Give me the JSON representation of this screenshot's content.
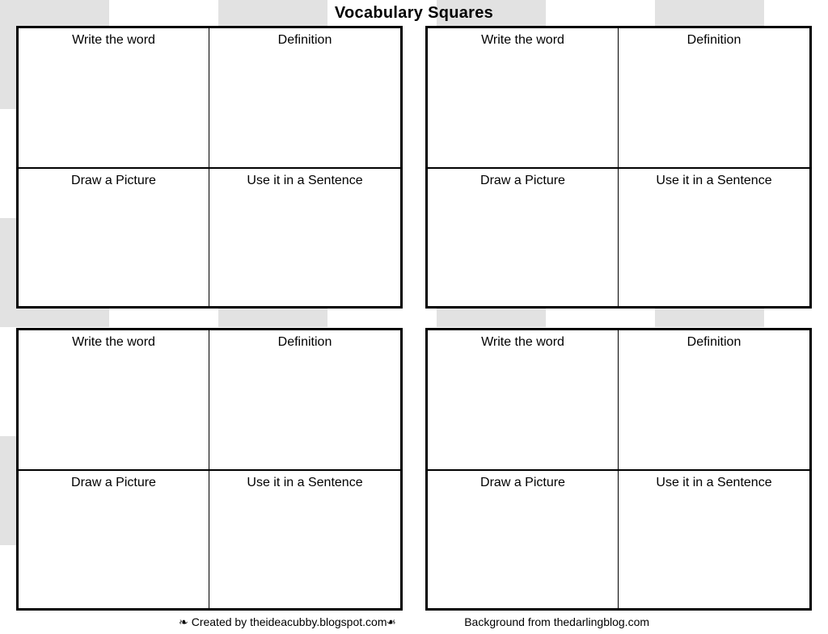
{
  "title": "Vocabulary Squares",
  "labels": {
    "write_word": "Write the word",
    "definition": "Definition",
    "draw_picture": "Draw a Picture",
    "use_sentence": "Use it in a Sentence"
  },
  "footer": {
    "created_by": "Created by theideacubby.blogspot.com",
    "background_from": "Background from thedarlingblog.com"
  }
}
